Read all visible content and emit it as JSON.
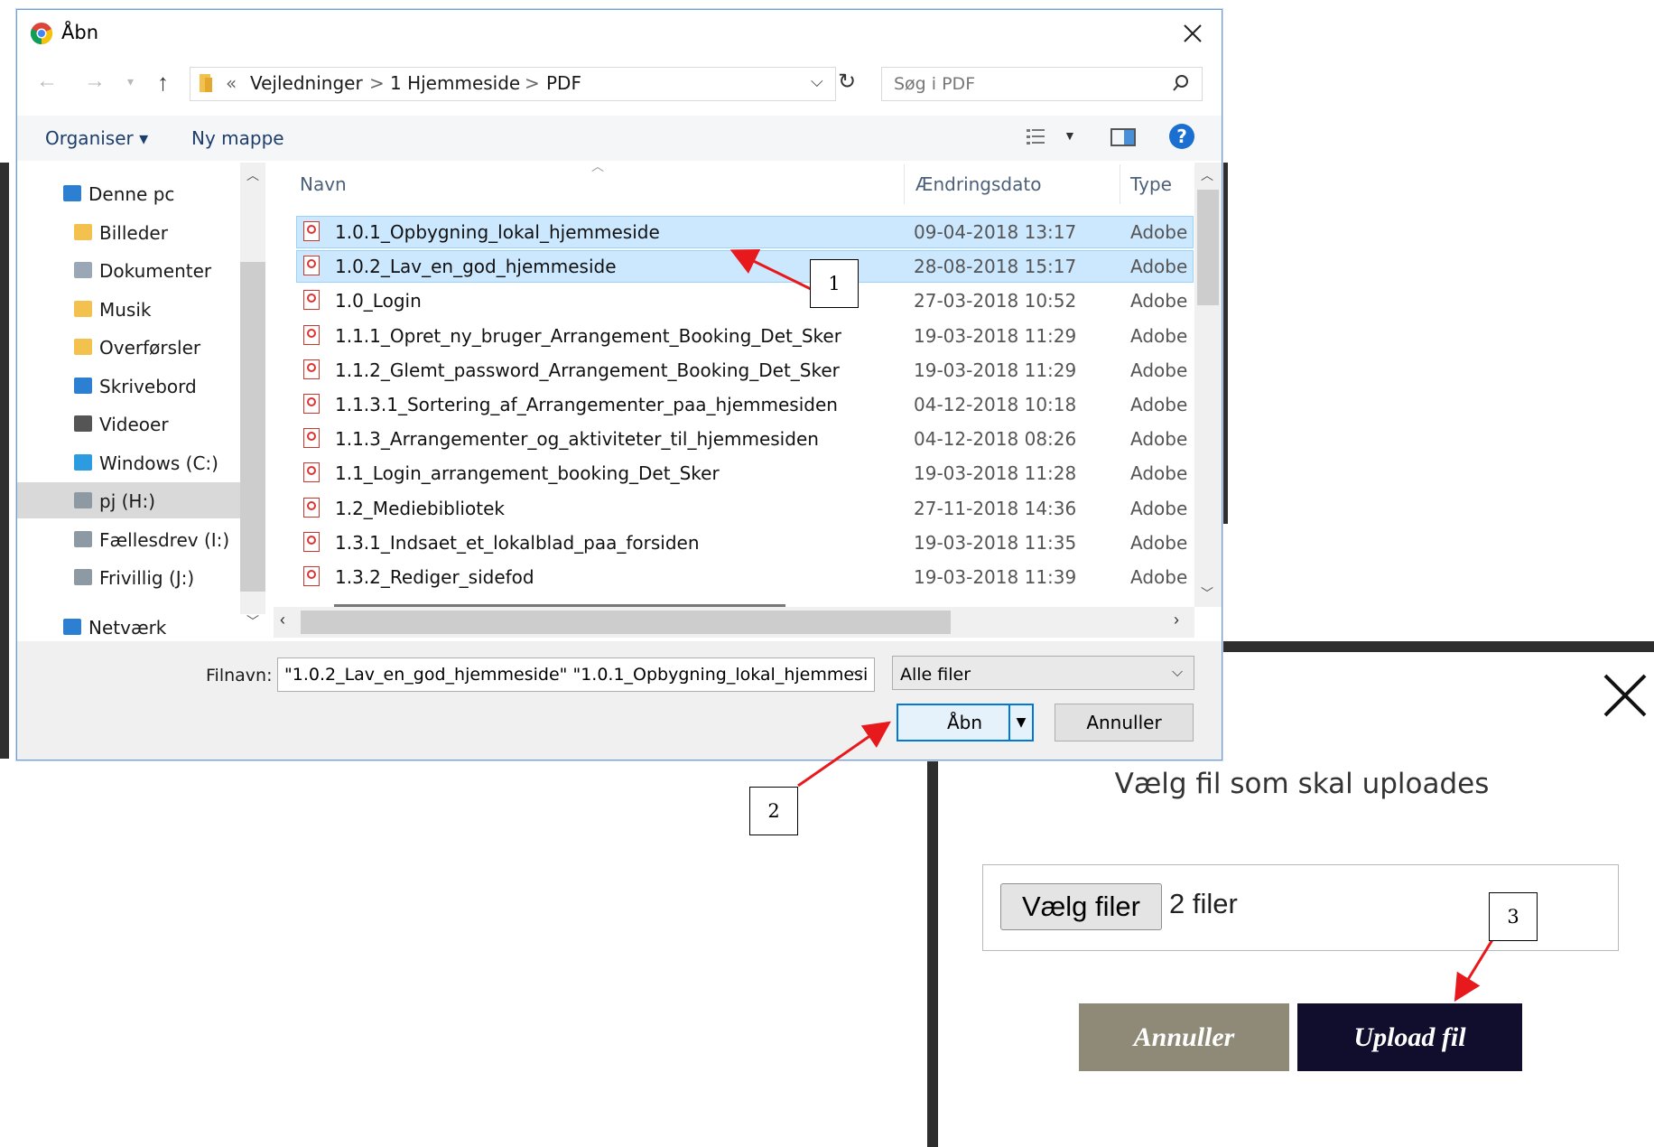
{
  "dialog": {
    "title": "Åbn",
    "breadcrumb": [
      "«",
      "Vejledninger",
      ">",
      "1 Hjemmeside",
      ">",
      "PDF"
    ],
    "search_placeholder": "Søg i PDF",
    "organize_label": "Organiser",
    "new_folder_label": "Ny mappe",
    "columns": {
      "name": "Navn",
      "date": "Ændringsdato",
      "type": "Type"
    },
    "sidebar": [
      {
        "label": "Denne pc",
        "icon": "computer-icon"
      },
      {
        "label": "Billeder",
        "icon": "pictures-folder-icon"
      },
      {
        "label": "Dokumenter",
        "icon": "documents-folder-icon"
      },
      {
        "label": "Musik",
        "icon": "music-folder-icon"
      },
      {
        "label": "Overførsler",
        "icon": "downloads-folder-icon"
      },
      {
        "label": "Skrivebord",
        "icon": "desktop-folder-icon"
      },
      {
        "label": "Videoer",
        "icon": "videos-folder-icon"
      },
      {
        "label": "Windows (C:)",
        "icon": "windows-drive-icon"
      },
      {
        "label": "pj (H:)",
        "icon": "network-drive-icon"
      },
      {
        "label": "Fællesdrev (I:)",
        "icon": "network-drive-icon"
      },
      {
        "label": "Frivillig (J:)",
        "icon": "network-drive-icon"
      },
      {
        "label": "Netværk",
        "icon": "network-icon"
      }
    ],
    "files": [
      {
        "name": "1.0.1_Opbygning_lokal_hjemmeside",
        "date": "09-04-2018 13:17",
        "type": "Adobe",
        "selected": true
      },
      {
        "name": "1.0.2_Lav_en_god_hjemmeside",
        "date": "28-08-2018 15:17",
        "type": "Adobe",
        "selected": true
      },
      {
        "name": "1.0_Login",
        "date": "27-03-2018 10:52",
        "type": "Adobe",
        "selected": false
      },
      {
        "name": "1.1.1_Opret_ny_bruger_Arrangement_Booking_Det_Sker",
        "date": "19-03-2018 11:29",
        "type": "Adobe",
        "selected": false
      },
      {
        "name": "1.1.2_Glemt_password_Arrangement_Booking_Det_Sker",
        "date": "19-03-2018 11:29",
        "type": "Adobe",
        "selected": false
      },
      {
        "name": "1.1.3.1_Sortering_af_Arrangementer_paa_hjemmesiden",
        "date": "04-12-2018 10:18",
        "type": "Adobe",
        "selected": false
      },
      {
        "name": "1.1.3_Arrangementer_og_aktiviteter_til_hjemmesiden",
        "date": "04-12-2018 08:26",
        "type": "Adobe",
        "selected": false
      },
      {
        "name": "1.1_Login_arrangement_booking_Det_Sker",
        "date": "19-03-2018 11:28",
        "type": "Adobe",
        "selected": false
      },
      {
        "name": "1.2_Mediebibliotek",
        "date": "27-11-2018 14:36",
        "type": "Adobe",
        "selected": false
      },
      {
        "name": "1.3.1_Indsaet_et_lokalblad_paa_forsiden",
        "date": "19-03-2018 11:35",
        "type": "Adobe",
        "selected": false
      },
      {
        "name": "1.3.2_Rediger_sidefod",
        "date": "19-03-2018 11:39",
        "type": "Adobe",
        "selected": false
      }
    ],
    "filename_label": "Filnavn:",
    "filename_value": "\"1.0.2_Lav_en_god_hjemmeside\" \"1.0.1_Opbygning_lokal_hjemmesi",
    "filetype_value": "Alle filer",
    "open_label": "Åbn",
    "cancel_label": "Annuller"
  },
  "upload_modal": {
    "heading": "Vælg fil som skal uploades",
    "choose_label": "Vælg filer",
    "file_count": "2 filer",
    "cancel_label": "Annuller",
    "upload_label": "Upload fil"
  },
  "callouts": [
    "1",
    "2",
    "3"
  ],
  "colors": {
    "selection": "#cce8ff",
    "annotation_arrow": "#e8191c",
    "upload_button": "#100d2d",
    "cancel_button": "#8f8a78",
    "help_icon": "#1a6fd1"
  }
}
